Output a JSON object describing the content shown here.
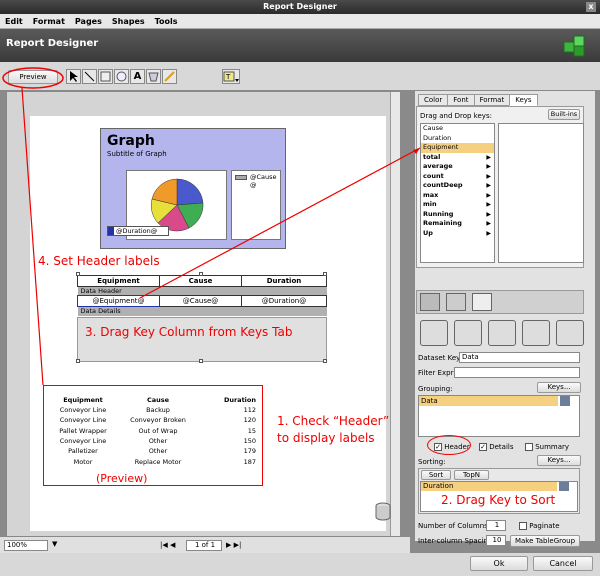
{
  "window": {
    "title": "Report Designer",
    "close": "x"
  },
  "menu": [
    "Edit",
    "Format",
    "Pages",
    "Shapes",
    "Tools"
  ],
  "header": {
    "title": "Report Designer"
  },
  "toolbar": {
    "preview": "Preview"
  },
  "graph": {
    "title": "Graph",
    "subtitle": "Subtitle of Graph",
    "legend": "@Cause\n@",
    "duration": "@Duration@"
  },
  "table": {
    "headers": [
      "Equipment",
      "Cause",
      "Duration"
    ],
    "data_header": "Data Header",
    "row": [
      "@Equipment@",
      "@Cause@",
      "@Duration@"
    ],
    "data_details": "Data Details"
  },
  "preview": {
    "headers": [
      "Equipment",
      "Cause",
      "Duration"
    ],
    "rows": [
      [
        "Conveyor Line",
        "Backup",
        "112"
      ],
      [
        "Conveyor Line",
        "Conveyor Broken",
        "120"
      ],
      [
        "Pallet Wrapper",
        "Out of Wrap",
        "15"
      ],
      [
        "Conveyor Line",
        "Other",
        "150"
      ],
      [
        "Palletizer",
        "Other",
        "179"
      ],
      [
        "Motor",
        "Replace Motor",
        "187"
      ]
    ],
    "label": "(Preview)"
  },
  "annotations": {
    "a1": "4. Set Header labels",
    "a2": "3. Drag Key Column from Keys Tab",
    "a3": "1. Check “Header” to display labels",
    "a4": "2. Drag Key to Sort"
  },
  "panel": {
    "tabs": [
      "Color",
      "Font",
      "Format",
      "Keys"
    ],
    "drag_label": "Drag and Drop keys:",
    "builtins": "Built-ins",
    "keys": [
      {
        "name": "Cause",
        "bold": false,
        "arrow": false,
        "selected": false
      },
      {
        "name": "Duration",
        "bold": false,
        "arrow": false,
        "selected": false
      },
      {
        "name": "Equipment",
        "bold": false,
        "arrow": false,
        "selected": true
      },
      {
        "name": "total",
        "bold": true,
        "arrow": true,
        "selected": false
      },
      {
        "name": "average",
        "bold": true,
        "arrow": true,
        "selected": false
      },
      {
        "name": "count",
        "bold": true,
        "arrow": true,
        "selected": false
      },
      {
        "name": "countDeep",
        "bold": true,
        "arrow": true,
        "selected": false
      },
      {
        "name": "max",
        "bold": true,
        "arrow": true,
        "selected": false
      },
      {
        "name": "min",
        "bold": true,
        "arrow": true,
        "selected": false
      },
      {
        "name": "Running",
        "bold": true,
        "arrow": true,
        "selected": false
      },
      {
        "name": "Remaining",
        "bold": true,
        "arrow": true,
        "selected": false
      },
      {
        "name": "Up",
        "bold": true,
        "arrow": true,
        "selected": false
      }
    ],
    "dataset_key_label": "Dataset Key:",
    "dataset_key": "Data",
    "filter_label": "Filter Expr:",
    "filter": "",
    "grouping_label": "Grouping:",
    "keys_btn": "Keys...",
    "grouping_item": "Data",
    "header_cb": "Header",
    "details_cb": "Details",
    "summary_cb": "Summary",
    "sorting_label": "Sorting:",
    "sort_tab": "Sort",
    "topn_tab": "TopN",
    "sort_item": "Duration",
    "columns_label": "Number of Columns:",
    "columns": "1",
    "paginate": "Paginate",
    "spacing_label": "Inter-column Spacing:",
    "spacing": "10",
    "make_group": "Make TableGroup"
  },
  "status": {
    "zoom": "100%",
    "page": "1 of 1"
  },
  "buttons": {
    "ok": "Ok",
    "cancel": "Cancel"
  },
  "colors": {
    "accent": "#e00000",
    "selection": "#f5d080",
    "graph_bg": "#b5b5ee"
  }
}
